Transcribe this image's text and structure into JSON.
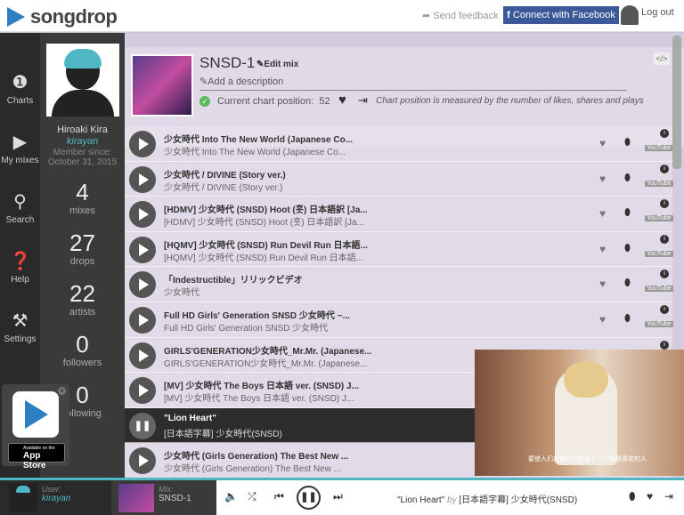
{
  "app": {
    "name": "songdrop"
  },
  "header": {
    "feedback": "Send feedback",
    "facebook": "Connect with Facebook",
    "logout": "Log out"
  },
  "nav": [
    {
      "label": "Charts",
      "icon": "chart-icon"
    },
    {
      "label": "My mixes",
      "icon": "play-icon"
    },
    {
      "label": "Search",
      "icon": "search-icon"
    },
    {
      "label": "Help",
      "icon": "help-icon"
    },
    {
      "label": "Settings",
      "icon": "settings-icon"
    }
  ],
  "profile": {
    "name": "Hiroaki Kira",
    "handle": "kirayan",
    "member_since_label": "Member since:",
    "member_since": "October 31, 2015",
    "stats": [
      {
        "value": "4",
        "label": "mixes"
      },
      {
        "value": "27",
        "label": "drops"
      },
      {
        "value": "22",
        "label": "artists"
      },
      {
        "value": "0",
        "label": "followers"
      },
      {
        "value": "0",
        "label": "following"
      }
    ]
  },
  "mix": {
    "title": "SNSD-1",
    "edit": "Edit mix",
    "add_description": "Add a description",
    "chart_position_label": "Current chart position:",
    "chart_position": "52",
    "chart_note": "Chart position is measured by the number of likes, shares and plays",
    "embed": "</>"
  },
  "tracks": [
    {
      "title": "少女時代 Into The New World (Japanese Co...",
      "subtitle": "少女時代 Into The New World (Japanese Co..."
    },
    {
      "title": "少女時代 / DIVINE (Story ver.)",
      "subtitle": "少女時代 / DIVINE (Story ver.)"
    },
    {
      "title": "[HDMV] 少女時代 (SNSD) Hoot (훗) 日本語訳 [Ja...",
      "subtitle": "[HDMV] 少女時代 (SNSD) Hoot (훗) 日本語訳 [Ja..."
    },
    {
      "title": "[HQMV] 少女時代 (SNSD) Run Devil Run 日本語...",
      "subtitle": "[HQMV] 少女時代 (SNSD) Run Devil Run 日本語..."
    },
    {
      "title": "「Indestructible」リリックビデオ",
      "subtitle": "少女時代"
    },
    {
      "title": "Full HD Girls' Generation SNSD 少女時代 ~...",
      "subtitle": "Full HD Girls' Generation SNSD 少女時代"
    },
    {
      "title": "GIRLS'GENERATION少女時代_Mr.Mr. (Japanese...",
      "subtitle": "GIRLS'GENERATION少女時代_Mr.Mr. (Japanese..."
    },
    {
      "title": "[MV] 少女時代 The Boys 日本語 ver. (SNSD) J...",
      "subtitle": "[MV] 少女時代 The Boys 日本語 ver. (SNSD) J..."
    },
    {
      "title": "\"Lion Heart\"",
      "subtitle": "[日本語字幕] 少女時代(SNSD)"
    },
    {
      "title": "少女時代 (Girls Generation) The Best New ...",
      "subtitle": "少女時代 (Girls Generation) The Best New ..."
    }
  ],
  "track_youtube": "YouTube",
  "video": {
    "subtitle": "要使人们在偶然间伤害了一个我很喜欢的人"
  },
  "appstore": {
    "small": "Available on the",
    "big": "App Store"
  },
  "player": {
    "user_label": "User:",
    "user": "kirayan",
    "mix_label": "Mix:",
    "mix": "SNSD-1",
    "now_title": "\"Lion Heart\"",
    "now_by": "by",
    "now_artist": "[日本語字幕] 少女時代(SNSD)"
  },
  "colors": {
    "accent": "#4fb7c4",
    "facebook": "#3b5998",
    "logo": "#2d7fc1"
  }
}
